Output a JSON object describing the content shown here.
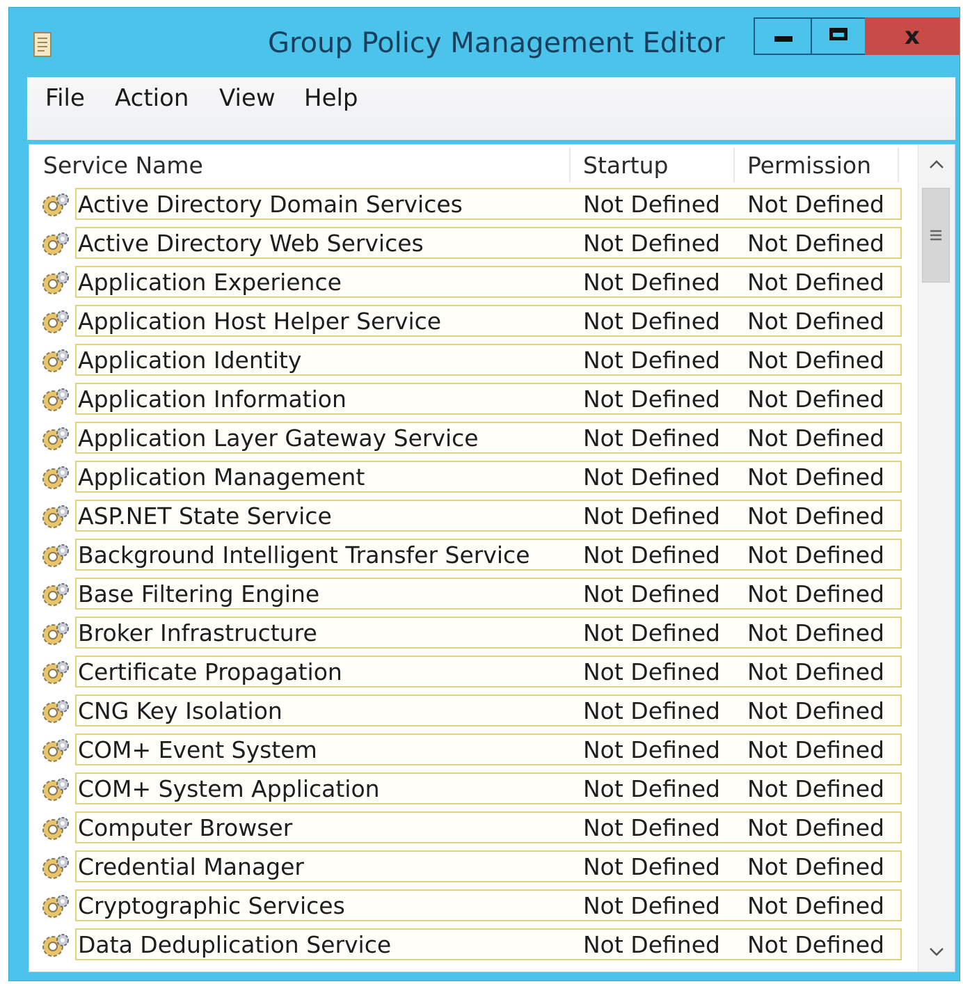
{
  "window": {
    "title": "Group Policy Management Editor",
    "accent_color": "#4cc3ea",
    "close_color": "#c94b47",
    "close_label": "x"
  },
  "menu": [
    "File",
    "Action",
    "View",
    "Help"
  ],
  "columns": {
    "name": "Service Name",
    "startup": "Startup",
    "permission": "Permission"
  },
  "services": [
    {
      "name": "Active Directory Domain Services",
      "startup": "Not Defined",
      "permission": "Not Defined"
    },
    {
      "name": "Active Directory Web Services",
      "startup": "Not Defined",
      "permission": "Not Defined"
    },
    {
      "name": "Application Experience",
      "startup": "Not Defined",
      "permission": "Not Defined"
    },
    {
      "name": "Application Host Helper Service",
      "startup": "Not Defined",
      "permission": "Not Defined"
    },
    {
      "name": "Application Identity",
      "startup": "Not Defined",
      "permission": "Not Defined"
    },
    {
      "name": "Application Information",
      "startup": "Not Defined",
      "permission": "Not Defined"
    },
    {
      "name": "Application Layer Gateway Service",
      "startup": "Not Defined",
      "permission": "Not Defined"
    },
    {
      "name": "Application Management",
      "startup": "Not Defined",
      "permission": "Not Defined"
    },
    {
      "name": "ASP.NET State Service",
      "startup": "Not Defined",
      "permission": "Not Defined"
    },
    {
      "name": "Background Intelligent Transfer Service",
      "startup": "Not Defined",
      "permission": "Not Defined"
    },
    {
      "name": "Base Filtering Engine",
      "startup": "Not Defined",
      "permission": "Not Defined"
    },
    {
      "name": "Broker Infrastructure",
      "startup": "Not Defined",
      "permission": "Not Defined"
    },
    {
      "name": "Certificate Propagation",
      "startup": "Not Defined",
      "permission": "Not Defined"
    },
    {
      "name": "CNG Key Isolation",
      "startup": "Not Defined",
      "permission": "Not Defined"
    },
    {
      "name": "COM+ Event System",
      "startup": "Not Defined",
      "permission": "Not Defined"
    },
    {
      "name": "COM+ System Application",
      "startup": "Not Defined",
      "permission": "Not Defined"
    },
    {
      "name": "Computer Browser",
      "startup": "Not Defined",
      "permission": "Not Defined"
    },
    {
      "name": "Credential Manager",
      "startup": "Not Defined",
      "permission": "Not Defined"
    },
    {
      "name": "Cryptographic Services",
      "startup": "Not Defined",
      "permission": "Not Defined"
    },
    {
      "name": "Data Deduplication Service",
      "startup": "Not Defined",
      "permission": "Not Defined"
    }
  ],
  "icons": {
    "row": "service-gear-icon",
    "app": "policy-document-icon",
    "scroll_up": "chevron-up-icon",
    "scroll_down": "chevron-down-icon",
    "thumb": "grip-icon"
  }
}
